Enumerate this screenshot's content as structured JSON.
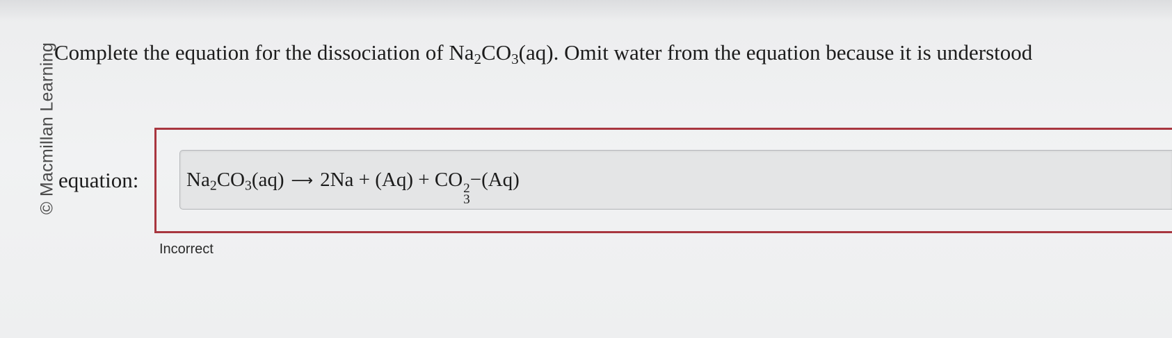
{
  "watermark": "© Macmillan Learning",
  "question": {
    "prefix": "Complete the equation for the dissociation of Na",
    "na_sub": "2",
    "co": "CO",
    "co_sub": "3",
    "suffix": "(aq). Omit water from the equation because it is understood"
  },
  "equation_label": "equation:",
  "answer": {
    "reactant_na": "Na",
    "reactant_na_sub": "2",
    "reactant_co": "CO",
    "reactant_co_sub": "3",
    "reactant_state": "(aq)",
    "arrow": "⟶",
    "product_1": "2Na + (Aq) + CO",
    "product_2_sup": "2",
    "product_2_sub": "3",
    "product_2_tail": "−(Aq)"
  },
  "status": "Incorrect",
  "colors": {
    "error_border": "#a8363f",
    "field_background": "#e4e5e6"
  }
}
